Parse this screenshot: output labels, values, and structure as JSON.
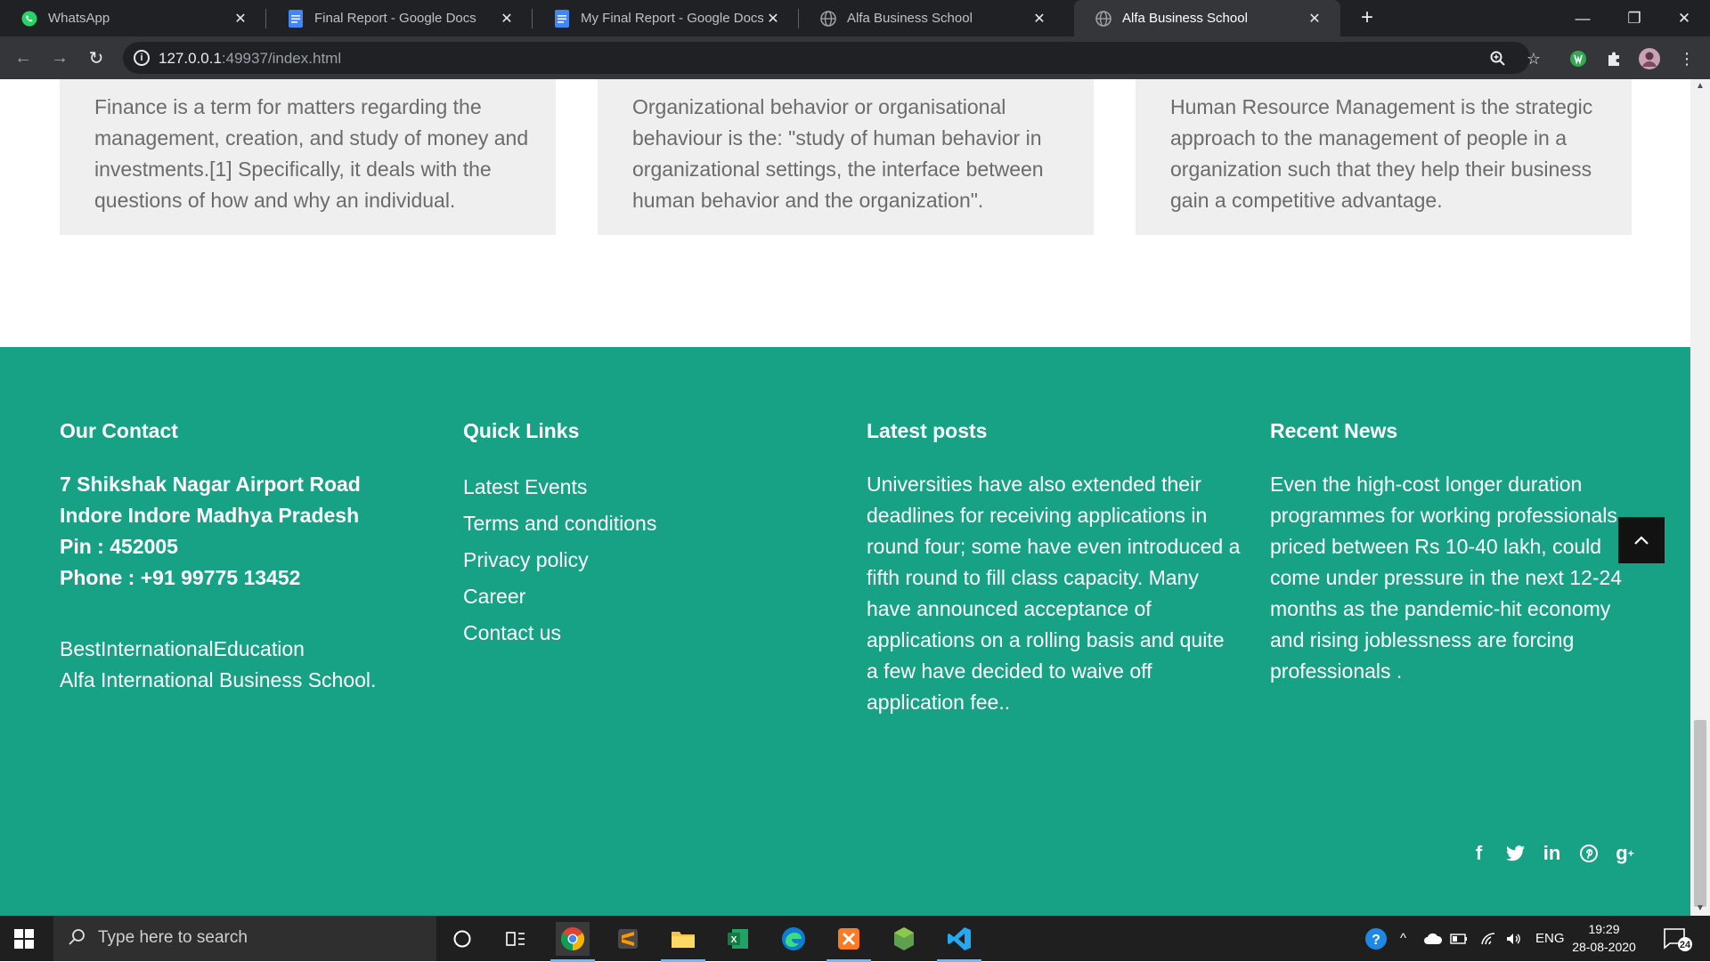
{
  "browser": {
    "tabs": [
      {
        "title": "WhatsApp",
        "icon": "whatsapp-icon",
        "active": false
      },
      {
        "title": "Final Report - Google Docs",
        "icon": "google-docs-icon",
        "active": false
      },
      {
        "title": "My Final Report - Google Docs",
        "icon": "google-docs-icon",
        "active": false
      },
      {
        "title": "Alfa Business School",
        "icon": "globe-icon",
        "active": false
      },
      {
        "title": "Alfa Business School",
        "icon": "globe-icon",
        "active": true
      }
    ],
    "url_host": "127.0.0.1",
    "url_rest": ":49937/index.html"
  },
  "cards": [
    {
      "text": "Finance is a term for matters regarding the management, creation, and study of money and investments.[1] Specifically, it deals with the questions of how and why an individual."
    },
    {
      "text": "Organizational behavior or organisational behaviour is the: \"study of human behavior in organizational settings, the interface between human behavior and the organization\"."
    },
    {
      "text": "Human Resource Management is the strategic approach to the management of people in a organization such that they help their business gain a competitive advantage."
    }
  ],
  "footer": {
    "contact": {
      "heading": "Our Contact",
      "address_line1": "7 Shikshak Nagar Airport Road",
      "address_line2": "Indore Indore Madhya Pradesh",
      "pin": "Pin : 452005",
      "phone": "Phone : +91 99775 13452",
      "tagline1": "BestInternationalEducation",
      "tagline2": "Alfa International Business School."
    },
    "quick_links": {
      "heading": "Quick Links",
      "items": [
        "Latest Events",
        "Terms and conditions",
        "Privacy policy",
        "Career",
        "Contact us"
      ]
    },
    "latest_posts": {
      "heading": "Latest posts",
      "text": "Universities have also extended their deadlines for receiving applications in round four; some have even introduced a fifth round to fill class capacity. Many have announced acceptance of applications on a rolling basis and quite a few have decided to waive off application fee.."
    },
    "recent_news": {
      "heading": "Recent News",
      "text": "Even the high-cost longer duration programmes for working professionals, priced between Rs 10-40 lakh, could come under pressure in the next 12-24 months as the pandemic-hit economy and rising joblessness are forcing professionals ."
    },
    "social": [
      "facebook-icon",
      "twitter-icon",
      "linkedin-icon",
      "pinterest-icon",
      "google-plus-icon"
    ]
  },
  "colors": {
    "footer_bg": "#17a185",
    "card_bg": "#efefef"
  },
  "taskbar": {
    "search_placeholder": "Type here to search",
    "language": "ENG",
    "time": "19:29",
    "date": "28-08-2020",
    "notifications": "24"
  }
}
